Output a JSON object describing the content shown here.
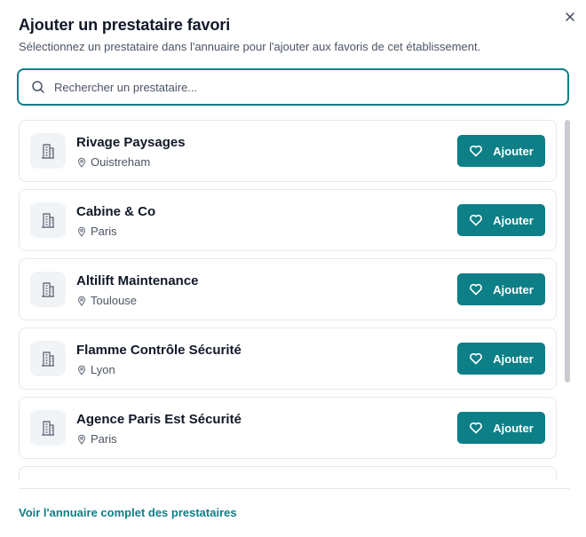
{
  "dialog": {
    "title": "Ajouter un prestataire favori",
    "subtitle": "Sélectionnez un prestataire dans l'annuaire pour l'ajouter aux favoris de cet établissement.",
    "close_icon": "close-icon"
  },
  "search": {
    "placeholder": "Rechercher un prestataire...",
    "value": "",
    "icon": "search-icon"
  },
  "providers": [
    {
      "name": "Rivage Paysages",
      "city": "Ouistreham",
      "action_label": "Ajouter"
    },
    {
      "name": "Cabine & Co",
      "city": "Paris",
      "action_label": "Ajouter"
    },
    {
      "name": "Altilift Maintenance",
      "city": "Toulouse",
      "action_label": "Ajouter"
    },
    {
      "name": "Flamme Contrôle Sécurité",
      "city": "Lyon",
      "action_label": "Ajouter"
    },
    {
      "name": "Agence Paris Est Sécurité",
      "city": "Paris",
      "action_label": "Ajouter"
    },
    {
      "name": "",
      "city": "",
      "action_label": ""
    }
  ],
  "icons": {
    "avatar": "building-icon",
    "location": "map-pin-icon",
    "action": "heart-icon"
  },
  "footer": {
    "link_label": "Voir l'annuaire complet des prestataires"
  },
  "colors": {
    "accent": "#0d7f86",
    "text": "#111827",
    "muted": "#4b5563",
    "border": "#e5e7eb",
    "avatar_bg": "#f1f4f7"
  }
}
